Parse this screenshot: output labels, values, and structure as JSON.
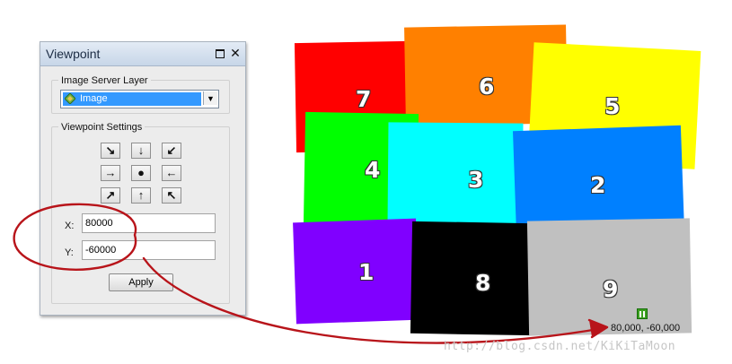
{
  "window": {
    "title": "Viewpoint",
    "pin_icon": "dock-pin-icon",
    "close_label": "✕"
  },
  "image_layer": {
    "label": "Image Server Layer",
    "selected": "Image",
    "icon": "raster-layer-icon",
    "dropdown_arrow": "▼"
  },
  "settings": {
    "label": "Viewpoint Settings",
    "nav_buttons": [
      "↘",
      "↓",
      "↙",
      "→",
      "●",
      "←",
      "↗",
      "↑",
      "↖"
    ],
    "x_label": "X:",
    "x_value": "80000",
    "y_label": "Y:",
    "y_value": "-60000",
    "apply_label": "Apply"
  },
  "tiles": [
    {
      "number": "7",
      "color": "#ff0000"
    },
    {
      "number": "6",
      "color": "#ff8000"
    },
    {
      "number": "5",
      "color": "#ffff00"
    },
    {
      "number": "4",
      "color": "#00ff00"
    },
    {
      "number": "3",
      "color": "#00ffff"
    },
    {
      "number": "2",
      "color": "#0080ff"
    },
    {
      "number": "1",
      "color": "#8000ff"
    },
    {
      "number": "8",
      "color": "#000000"
    },
    {
      "number": "9",
      "color": "#c0c0c0"
    }
  ],
  "map": {
    "coordinate_readout": "80,000, -60,000",
    "cursor_icon": "map-cursor-icon"
  },
  "annotation": {
    "color": "#b8141a"
  },
  "watermark": "http://blog.csdn.net/KiKiTaMoon"
}
